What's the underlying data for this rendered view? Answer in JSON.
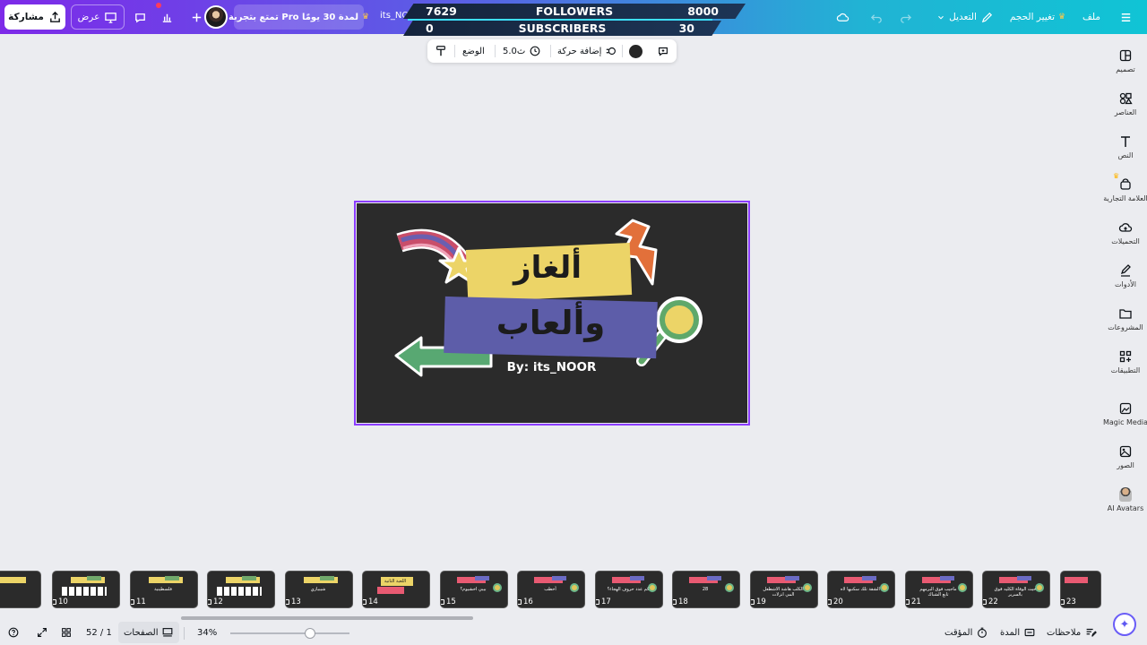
{
  "topbar": {
    "share_label": "مشاركة",
    "present_label": "عرض",
    "promo_label": "تمتع بتجربة Pro لمدة 30 يومًا",
    "project_title": "its_NO",
    "file_label": "ملف",
    "resize_label": "تغيير الحجم",
    "edit_label": "التعديل"
  },
  "overlay": {
    "followers_count": "7629",
    "followers_label": "FOLLOWERS",
    "followers_goal": "8000",
    "subscribers_count": "0",
    "subscribers_label": "SUBSCRIBERS",
    "subscribers_goal": "30",
    "followers_progress_fraction": 0.954
  },
  "context_toolbar": {
    "animate_label": "إضافة حركة",
    "duration_label": "5.0ث",
    "position_label": "الوضع",
    "color": "#262626"
  },
  "sidebar": {
    "items": [
      {
        "label": "تصميم",
        "icon": "design-icon"
      },
      {
        "label": "العناصر",
        "icon": "elements-icon"
      },
      {
        "label": "النص",
        "icon": "text-icon"
      },
      {
        "label": "العلامة التجارية",
        "icon": "brand-icon"
      },
      {
        "label": "التحميلات",
        "icon": "uploads-icon"
      },
      {
        "label": "الأدوات",
        "icon": "draw-icon"
      },
      {
        "label": "المشروعات",
        "icon": "projects-icon"
      },
      {
        "label": "التطبيقات",
        "icon": "apps-icon"
      },
      {
        "label": "Magic Media",
        "icon": "magic-media-icon"
      },
      {
        "label": "الصور",
        "icon": "photos-icon"
      },
      {
        "label": "AI Avatars",
        "icon": "ai-avatars-icon"
      }
    ]
  },
  "slide": {
    "title_line1": "ألغاز",
    "title_line2": "وألعاب",
    "byline": "By: its_NOOR"
  },
  "pages": {
    "thumbnails": [
      {
        "number": "10",
        "caption": ""
      },
      {
        "number": "11",
        "caption": "فلسطينية"
      },
      {
        "number": "12",
        "caption": ""
      },
      {
        "number": "13",
        "caption": "شيبيازي"
      },
      {
        "number": "14",
        "caption": "اللعبة الثانية"
      },
      {
        "number": "15",
        "caption": "بيبي اخشيوم؟"
      },
      {
        "number": "16",
        "caption": "أخطب"
      },
      {
        "number": "17",
        "caption": "كم عدد حروف الهجاء؟"
      },
      {
        "number": "18",
        "caption": "28"
      },
      {
        "number": "19",
        "caption": "الكلب هاشة الاشطعل المي انزلات"
      },
      {
        "number": "20",
        "caption": "الشقة تلك سكنيها لاه"
      },
      {
        "number": "21",
        "caption": "ماجيب فوق البرمهم تابع الشباك"
      },
      {
        "number": "22",
        "caption": "حيث الوفاة الكليه قوق بالسرير"
      },
      {
        "number": "23",
        "caption": ""
      }
    ]
  },
  "bottombar": {
    "notes_label": "ملاحظات",
    "duration_label": "المدة",
    "timer_label": "المؤقت",
    "pages_label": "الصفحات",
    "page_indicator": "52 / 1",
    "zoom_label": "34%",
    "zoom_fraction": 0.34
  },
  "colors": {
    "accent": "#8b3dff",
    "slide_bg": "#2b2b2b",
    "banner_yellow": "#ecd467",
    "banner_purple": "#5d5da9"
  }
}
